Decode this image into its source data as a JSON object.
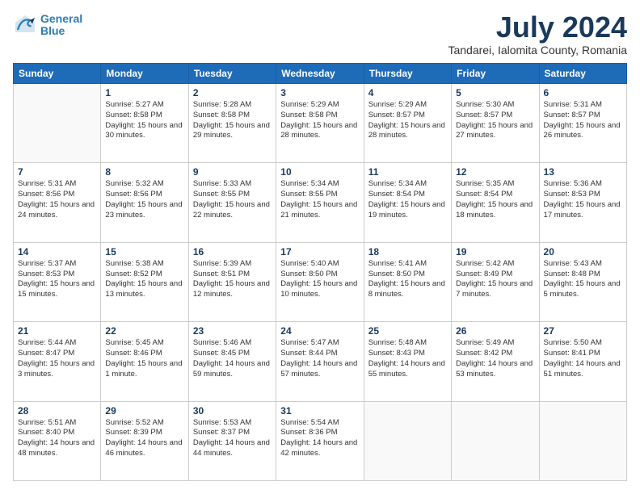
{
  "app": {
    "logo_line1": "General",
    "logo_line2": "Blue"
  },
  "header": {
    "month": "July 2024",
    "location": "Tandarei, Ialomita County, Romania"
  },
  "days_of_week": [
    "Sunday",
    "Monday",
    "Tuesday",
    "Wednesday",
    "Thursday",
    "Friday",
    "Saturday"
  ],
  "weeks": [
    [
      {
        "day": "",
        "empty": true
      },
      {
        "day": "1",
        "sunrise": "Sunrise: 5:27 AM",
        "sunset": "Sunset: 8:58 PM",
        "daylight": "Daylight: 15 hours and 30 minutes."
      },
      {
        "day": "2",
        "sunrise": "Sunrise: 5:28 AM",
        "sunset": "Sunset: 8:58 PM",
        "daylight": "Daylight: 15 hours and 29 minutes."
      },
      {
        "day": "3",
        "sunrise": "Sunrise: 5:29 AM",
        "sunset": "Sunset: 8:58 PM",
        "daylight": "Daylight: 15 hours and 28 minutes."
      },
      {
        "day": "4",
        "sunrise": "Sunrise: 5:29 AM",
        "sunset": "Sunset: 8:57 PM",
        "daylight": "Daylight: 15 hours and 28 minutes."
      },
      {
        "day": "5",
        "sunrise": "Sunrise: 5:30 AM",
        "sunset": "Sunset: 8:57 PM",
        "daylight": "Daylight: 15 hours and 27 minutes."
      },
      {
        "day": "6",
        "sunrise": "Sunrise: 5:31 AM",
        "sunset": "Sunset: 8:57 PM",
        "daylight": "Daylight: 15 hours and 26 minutes."
      }
    ],
    [
      {
        "day": "7",
        "sunrise": "Sunrise: 5:31 AM",
        "sunset": "Sunset: 8:56 PM",
        "daylight": "Daylight: 15 hours and 24 minutes."
      },
      {
        "day": "8",
        "sunrise": "Sunrise: 5:32 AM",
        "sunset": "Sunset: 8:56 PM",
        "daylight": "Daylight: 15 hours and 23 minutes."
      },
      {
        "day": "9",
        "sunrise": "Sunrise: 5:33 AM",
        "sunset": "Sunset: 8:55 PM",
        "daylight": "Daylight: 15 hours and 22 minutes."
      },
      {
        "day": "10",
        "sunrise": "Sunrise: 5:34 AM",
        "sunset": "Sunset: 8:55 PM",
        "daylight": "Daylight: 15 hours and 21 minutes."
      },
      {
        "day": "11",
        "sunrise": "Sunrise: 5:34 AM",
        "sunset": "Sunset: 8:54 PM",
        "daylight": "Daylight: 15 hours and 19 minutes."
      },
      {
        "day": "12",
        "sunrise": "Sunrise: 5:35 AM",
        "sunset": "Sunset: 8:54 PM",
        "daylight": "Daylight: 15 hours and 18 minutes."
      },
      {
        "day": "13",
        "sunrise": "Sunrise: 5:36 AM",
        "sunset": "Sunset: 8:53 PM",
        "daylight": "Daylight: 15 hours and 17 minutes."
      }
    ],
    [
      {
        "day": "14",
        "sunrise": "Sunrise: 5:37 AM",
        "sunset": "Sunset: 8:53 PM",
        "daylight": "Daylight: 15 hours and 15 minutes."
      },
      {
        "day": "15",
        "sunrise": "Sunrise: 5:38 AM",
        "sunset": "Sunset: 8:52 PM",
        "daylight": "Daylight: 15 hours and 13 minutes."
      },
      {
        "day": "16",
        "sunrise": "Sunrise: 5:39 AM",
        "sunset": "Sunset: 8:51 PM",
        "daylight": "Daylight: 15 hours and 12 minutes."
      },
      {
        "day": "17",
        "sunrise": "Sunrise: 5:40 AM",
        "sunset": "Sunset: 8:50 PM",
        "daylight": "Daylight: 15 hours and 10 minutes."
      },
      {
        "day": "18",
        "sunrise": "Sunrise: 5:41 AM",
        "sunset": "Sunset: 8:50 PM",
        "daylight": "Daylight: 15 hours and 8 minutes."
      },
      {
        "day": "19",
        "sunrise": "Sunrise: 5:42 AM",
        "sunset": "Sunset: 8:49 PM",
        "daylight": "Daylight: 15 hours and 7 minutes."
      },
      {
        "day": "20",
        "sunrise": "Sunrise: 5:43 AM",
        "sunset": "Sunset: 8:48 PM",
        "daylight": "Daylight: 15 hours and 5 minutes."
      }
    ],
    [
      {
        "day": "21",
        "sunrise": "Sunrise: 5:44 AM",
        "sunset": "Sunset: 8:47 PM",
        "daylight": "Daylight: 15 hours and 3 minutes."
      },
      {
        "day": "22",
        "sunrise": "Sunrise: 5:45 AM",
        "sunset": "Sunset: 8:46 PM",
        "daylight": "Daylight: 15 hours and 1 minute."
      },
      {
        "day": "23",
        "sunrise": "Sunrise: 5:46 AM",
        "sunset": "Sunset: 8:45 PM",
        "daylight": "Daylight: 14 hours and 59 minutes."
      },
      {
        "day": "24",
        "sunrise": "Sunrise: 5:47 AM",
        "sunset": "Sunset: 8:44 PM",
        "daylight": "Daylight: 14 hours and 57 minutes."
      },
      {
        "day": "25",
        "sunrise": "Sunrise: 5:48 AM",
        "sunset": "Sunset: 8:43 PM",
        "daylight": "Daylight: 14 hours and 55 minutes."
      },
      {
        "day": "26",
        "sunrise": "Sunrise: 5:49 AM",
        "sunset": "Sunset: 8:42 PM",
        "daylight": "Daylight: 14 hours and 53 minutes."
      },
      {
        "day": "27",
        "sunrise": "Sunrise: 5:50 AM",
        "sunset": "Sunset: 8:41 PM",
        "daylight": "Daylight: 14 hours and 51 minutes."
      }
    ],
    [
      {
        "day": "28",
        "sunrise": "Sunrise: 5:51 AM",
        "sunset": "Sunset: 8:40 PM",
        "daylight": "Daylight: 14 hours and 48 minutes."
      },
      {
        "day": "29",
        "sunrise": "Sunrise: 5:52 AM",
        "sunset": "Sunset: 8:39 PM",
        "daylight": "Daylight: 14 hours and 46 minutes."
      },
      {
        "day": "30",
        "sunrise": "Sunrise: 5:53 AM",
        "sunset": "Sunset: 8:37 PM",
        "daylight": "Daylight: 14 hours and 44 minutes."
      },
      {
        "day": "31",
        "sunrise": "Sunrise: 5:54 AM",
        "sunset": "Sunset: 8:36 PM",
        "daylight": "Daylight: 14 hours and 42 minutes."
      },
      {
        "day": "",
        "empty": true
      },
      {
        "day": "",
        "empty": true
      },
      {
        "day": "",
        "empty": true
      }
    ]
  ]
}
